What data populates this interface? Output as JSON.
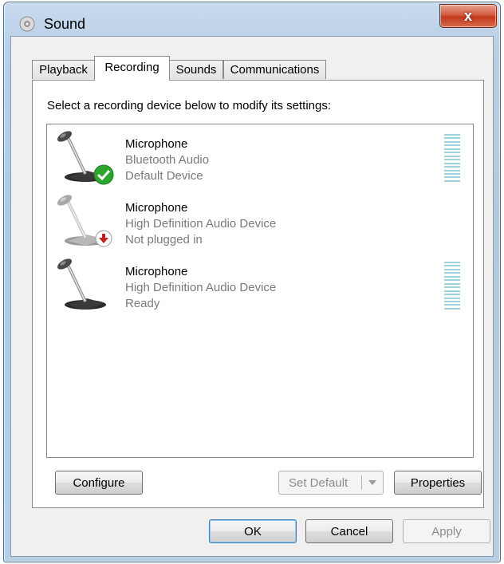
{
  "window": {
    "title": "Sound",
    "close_label": "x"
  },
  "tabs": [
    {
      "label": "Playback"
    },
    {
      "label": "Recording"
    },
    {
      "label": "Sounds"
    },
    {
      "label": "Communications"
    }
  ],
  "recording": {
    "instruction": "Select a recording device below to modify its settings:",
    "devices": [
      {
        "name": "Microphone",
        "description": "Bluetooth Audio",
        "status": "Default Device",
        "badge": "green-check-icon",
        "level_meter": true
      },
      {
        "name": "Microphone",
        "description": "High Definition Audio Device",
        "status": "Not plugged in",
        "badge": "red-down-arrow-icon",
        "level_meter": false
      },
      {
        "name": "Microphone",
        "description": "High Definition Audio Device",
        "status": "Ready",
        "badge": "",
        "level_meter": true
      }
    ],
    "buttons": {
      "configure": "Configure",
      "set_default": "Set Default",
      "properties": "Properties"
    }
  },
  "dialog_buttons": {
    "ok": "OK",
    "cancel": "Cancel",
    "apply": "Apply"
  },
  "colors": {
    "accent_check": "#2fa52f",
    "unplugged_red": "#c0201f",
    "meter": "#9fd2dc"
  }
}
